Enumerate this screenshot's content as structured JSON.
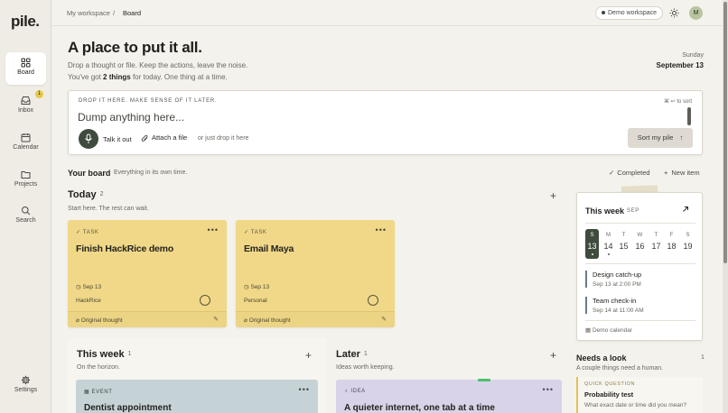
{
  "app": {
    "logo": "pile."
  },
  "sidebar": {
    "items": [
      {
        "label": "Board",
        "icon": "grid-icon",
        "active": true
      },
      {
        "label": "Inbox",
        "icon": "inbox-icon",
        "badge": "1"
      },
      {
        "label": "Calendar",
        "icon": "calendar-icon"
      },
      {
        "label": "Projects",
        "icon": "folder-icon"
      },
      {
        "label": "Search",
        "icon": "search-icon"
      }
    ],
    "settings_label": "Settings"
  },
  "topbar": {
    "breadcrumb_root": "My workspace",
    "breadcrumb_sep": "/",
    "breadcrumb_current": "Board",
    "workspace_label": "Demo workspace",
    "avatar_initial": "M"
  },
  "hero": {
    "title": "A place to put it all.",
    "subtitle": "Drop a thought or file. Keep the actions, leave the noise.",
    "status_prefix": "You've got ",
    "status_count": "2 things",
    "status_suffix": " for today. One thing at a time.",
    "day": "Sunday",
    "date": "September 13"
  },
  "dump": {
    "hint": "DROP IT HERE. MAKE SENSE OF IT LATER.",
    "sort_hint": "⌘ ↩ to sort",
    "placeholder": "Dump anything here...",
    "talk_label": "Talk it out",
    "attach_label": "Attach a file",
    "drop_label": "or just drop it here",
    "sort_button": "Sort my pile"
  },
  "board": {
    "title": "Your board",
    "subtitle": "Everything in its own time.",
    "completed_label": "Completed",
    "new_item_label": "New item"
  },
  "today": {
    "title": "Today",
    "count": "2",
    "subtitle": "Start here. The rest can wait.",
    "cards": [
      {
        "type": "TASK",
        "title": "Finish HackRice demo",
        "due": "Sep 13",
        "project": "HackRice",
        "footer": "Original thought"
      },
      {
        "type": "TASK",
        "title": "Email Maya",
        "due": "Sep 13",
        "project": "Personal",
        "footer": "Original thought"
      }
    ]
  },
  "this_week_section": {
    "title": "This week",
    "count": "1",
    "subtitle": "On the horizon.",
    "card": {
      "type": "EVENT",
      "title": "Dentist appointment"
    }
  },
  "later_section": {
    "title": "Later",
    "count": "1",
    "subtitle": "Ideas worth keeping.",
    "card": {
      "type": "IDEA",
      "title": "A quieter internet, one tab at a time"
    }
  },
  "calendar": {
    "title": "This week",
    "month": "SEP",
    "days": [
      {
        "d": "S",
        "n": "13",
        "selected": true,
        "dot": true
      },
      {
        "d": "M",
        "n": "14",
        "dot": true
      },
      {
        "d": "T",
        "n": "15"
      },
      {
        "d": "W",
        "n": "16"
      },
      {
        "d": "T",
        "n": "17"
      },
      {
        "d": "F",
        "n": "18"
      },
      {
        "d": "S",
        "n": "19"
      }
    ],
    "events": [
      {
        "title": "Design catch-up",
        "when": "Sep 13 at 2:00 PM"
      },
      {
        "title": "Team check-in",
        "when": "Sep 14 at 11:00 AM"
      }
    ],
    "source": "Demo calendar"
  },
  "needs_look": {
    "title": "Needs a look",
    "count": "1",
    "subtitle": "A couple things need a human.",
    "card": {
      "type": "QUICK QUESTION",
      "title": "Probability test",
      "text": "What exact date or time did you mean?"
    }
  },
  "colors": {
    "accent_dark": "#3e4b3d",
    "task_card": "#f0d888",
    "event_card": "#c6d3d6",
    "idea_card": "#d8d3e8",
    "badge": "#e7c84b"
  }
}
